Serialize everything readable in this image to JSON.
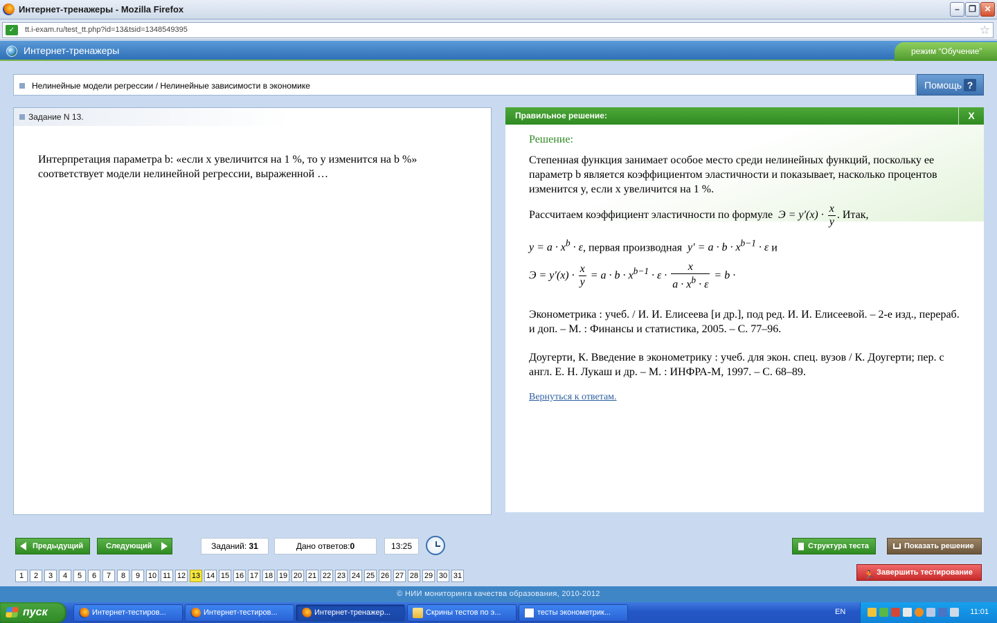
{
  "window": {
    "title": "Интернет-тренажеры - Mozilla Firefox",
    "minimize": "–",
    "maximize": "❐",
    "close": "✕"
  },
  "addressbar": {
    "url": "tt.i-exam.ru/test_tt.php?id=13&tsid=1348549395",
    "bookmark_star": "☆"
  },
  "app": {
    "title": "Интернет-тренажеры",
    "mode": "режим “Обучение”"
  },
  "breadcrumb": {
    "text": "Нелинейные модели регрессии / Нелинейные зависимости в экономике"
  },
  "help": {
    "label": "Помощь",
    "icon": "?"
  },
  "task": {
    "header": "Задание N 13.",
    "question": "Интерпретация параметра b: «если x увеличится на 1 %, то y изменится на b %» соответствует модели нелинейной регрессии, выраженной …"
  },
  "solution": {
    "header": "Правильное решение:",
    "close": "X",
    "heading": "Решение:",
    "p1": "Степенная функция занимает особое место среди нелинейных функций, поскольку ее параметр b является коэффициентом эластичности и показывает, насколько процентов изменится y, если x увеличится на 1 %.",
    "p2": "Рассчитаем коэффициент эластичности по формуле",
    "p2_after": ". Итак,",
    "line3_mid": ", первая производная",
    "line3_end": "и",
    "ref1": "Эконометрика : учеб. / И. И. Елисеева [и др.], под ред. И. И. Елисеевой. – 2-е изд., перераб. и доп. – М. : Финансы и статистика, 2005. – С. 77–96.",
    "ref2": "Доугерти, К. Введение в эконометрику : учеб. для экон. спец. вузов / К. Доугерти; пер. с англ. Е. Н. Лукаш и др. – М. : ИНФРА-М, 1997. – С. 68–89.",
    "back_link": "Вернуться к ответам."
  },
  "controls": {
    "prev": "Предыдущий",
    "next": "Следующий",
    "tasks_label": "Заданий:",
    "tasks_value": "31",
    "answers_label": "Дано ответов:",
    "answers_value": "0",
    "time": "13:25",
    "structure": "Структура теста",
    "show_solution": "Показать решение",
    "finish": "Завершить тестирование"
  },
  "pages": [
    "1",
    "2",
    "3",
    "4",
    "5",
    "6",
    "7",
    "8",
    "9",
    "10",
    "11",
    "12",
    "13",
    "14",
    "15",
    "16",
    "17",
    "18",
    "19",
    "20",
    "21",
    "22",
    "23",
    "24",
    "25",
    "26",
    "27",
    "28",
    "29",
    "30",
    "31"
  ],
  "current_page": "13",
  "footer": "© НИИ мониторинга качества образования, 2010-2012",
  "taskbar": {
    "start": "пуск",
    "tasks": [
      {
        "label": "Интернет-тестиров...",
        "icon": "firefox-icon"
      },
      {
        "label": "Интернет-тестиров...",
        "icon": "firefox-icon"
      },
      {
        "label": "Интернет-тренажер...",
        "icon": "firefox-icon"
      },
      {
        "label": "Скрины тестов по э...",
        "icon": "folder-icon"
      },
      {
        "label": "тесты эконометрик...",
        "icon": "word-doc-icon"
      }
    ],
    "lang": "EN",
    "clock": "11:01"
  }
}
